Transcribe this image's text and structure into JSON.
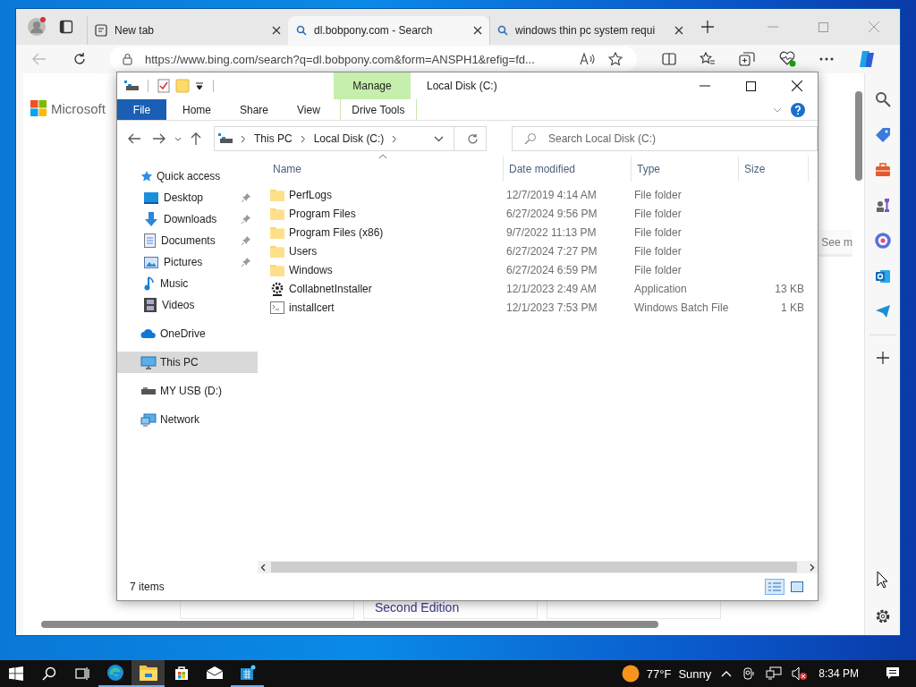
{
  "browser": {
    "tabs": [
      {
        "label": "New tab",
        "selected": false,
        "kind": "newtab"
      },
      {
        "label": "dl.bobpony.com - Search",
        "selected": true,
        "kind": "search"
      },
      {
        "label": "windows thin pc system requi",
        "selected": false,
        "kind": "search"
      }
    ],
    "address": "https://www.bing.com/search?q=dl.bobpony.com&form=ANSPH1&refig=fd...",
    "page": {
      "logo": "Microsoft",
      "card_text": "See m",
      "caption": "Second Edition"
    }
  },
  "explorer": {
    "title": "Local Disk (C:)",
    "ribbon_tabs": [
      {
        "label": "File",
        "kind": "file"
      },
      {
        "label": "Home",
        "kind": "tab"
      },
      {
        "label": "Share",
        "kind": "tab"
      },
      {
        "label": "View",
        "kind": "tab"
      },
      {
        "label": "Drive Tools",
        "kind": "context",
        "group": "Manage"
      }
    ],
    "breadcrumb": [
      "This PC",
      "Local Disk (C:)"
    ],
    "search": {
      "placeholder": "Search Local Disk (C:)"
    },
    "columns": [
      "Name",
      "Date modified",
      "Type",
      "Size"
    ],
    "rows": [
      {
        "name": "PerfLogs",
        "date": "12/7/2019 4:14 AM",
        "type": "File folder",
        "size": "",
        "kind": "folder"
      },
      {
        "name": "Program Files",
        "date": "6/27/2024 9:56 PM",
        "type": "File folder",
        "size": "",
        "kind": "folder"
      },
      {
        "name": "Program Files (x86)",
        "date": "9/7/2022 11:13 PM",
        "type": "File folder",
        "size": "",
        "kind": "folder"
      },
      {
        "name": "Users",
        "date": "6/27/2024 7:27 PM",
        "type": "File folder",
        "size": "",
        "kind": "folder"
      },
      {
        "name": "Windows",
        "date": "6/27/2024 6:59 PM",
        "type": "File folder",
        "size": "",
        "kind": "folder"
      },
      {
        "name": "CollabnetInstaller",
        "date": "12/1/2023 2:49 AM",
        "type": "Application",
        "size": "13 KB",
        "kind": "app"
      },
      {
        "name": "installcert",
        "date": "12/1/2023 7:53 PM",
        "type": "Windows Batch File",
        "size": "1 KB",
        "kind": "batch"
      }
    ],
    "nav": [
      {
        "label": "Quick access",
        "kind": "star",
        "selected": false,
        "children": [
          {
            "label": "Desktop",
            "kind": "desktop",
            "selected": false,
            "pinned": true
          },
          {
            "label": "Downloads",
            "kind": "download",
            "selected": false,
            "pinned": true
          },
          {
            "label": "Documents",
            "kind": "document",
            "selected": false,
            "pinned": true
          },
          {
            "label": "Pictures",
            "kind": "pictures",
            "selected": false,
            "pinned": true
          },
          {
            "label": "Music",
            "kind": "music",
            "selected": false,
            "pinned": false
          },
          {
            "label": "Videos",
            "kind": "videos",
            "selected": false,
            "pinned": false
          }
        ]
      },
      {
        "label": "OneDrive",
        "kind": "cloud",
        "selected": false
      },
      {
        "label": "This PC",
        "kind": "pc",
        "selected": true
      },
      {
        "label": "MY USB (D:)",
        "kind": "usb",
        "selected": false
      },
      {
        "label": "Network",
        "kind": "network",
        "selected": false
      }
    ],
    "status": "7 items",
    "views": [
      {
        "kind": "details",
        "selected": true
      },
      {
        "kind": "large",
        "selected": false
      }
    ]
  },
  "taskbar": {
    "apps": [
      {
        "kind": "edge",
        "running": true,
        "selected": false
      },
      {
        "kind": "explorer",
        "running": true,
        "selected": true
      },
      {
        "kind": "store",
        "running": false,
        "selected": false
      },
      {
        "kind": "mail",
        "running": false,
        "selected": false
      },
      {
        "kind": "app",
        "running": true,
        "selected": false
      }
    ],
    "temperature": "77°F",
    "weather": "Sunny",
    "time": "8:34 PM"
  }
}
